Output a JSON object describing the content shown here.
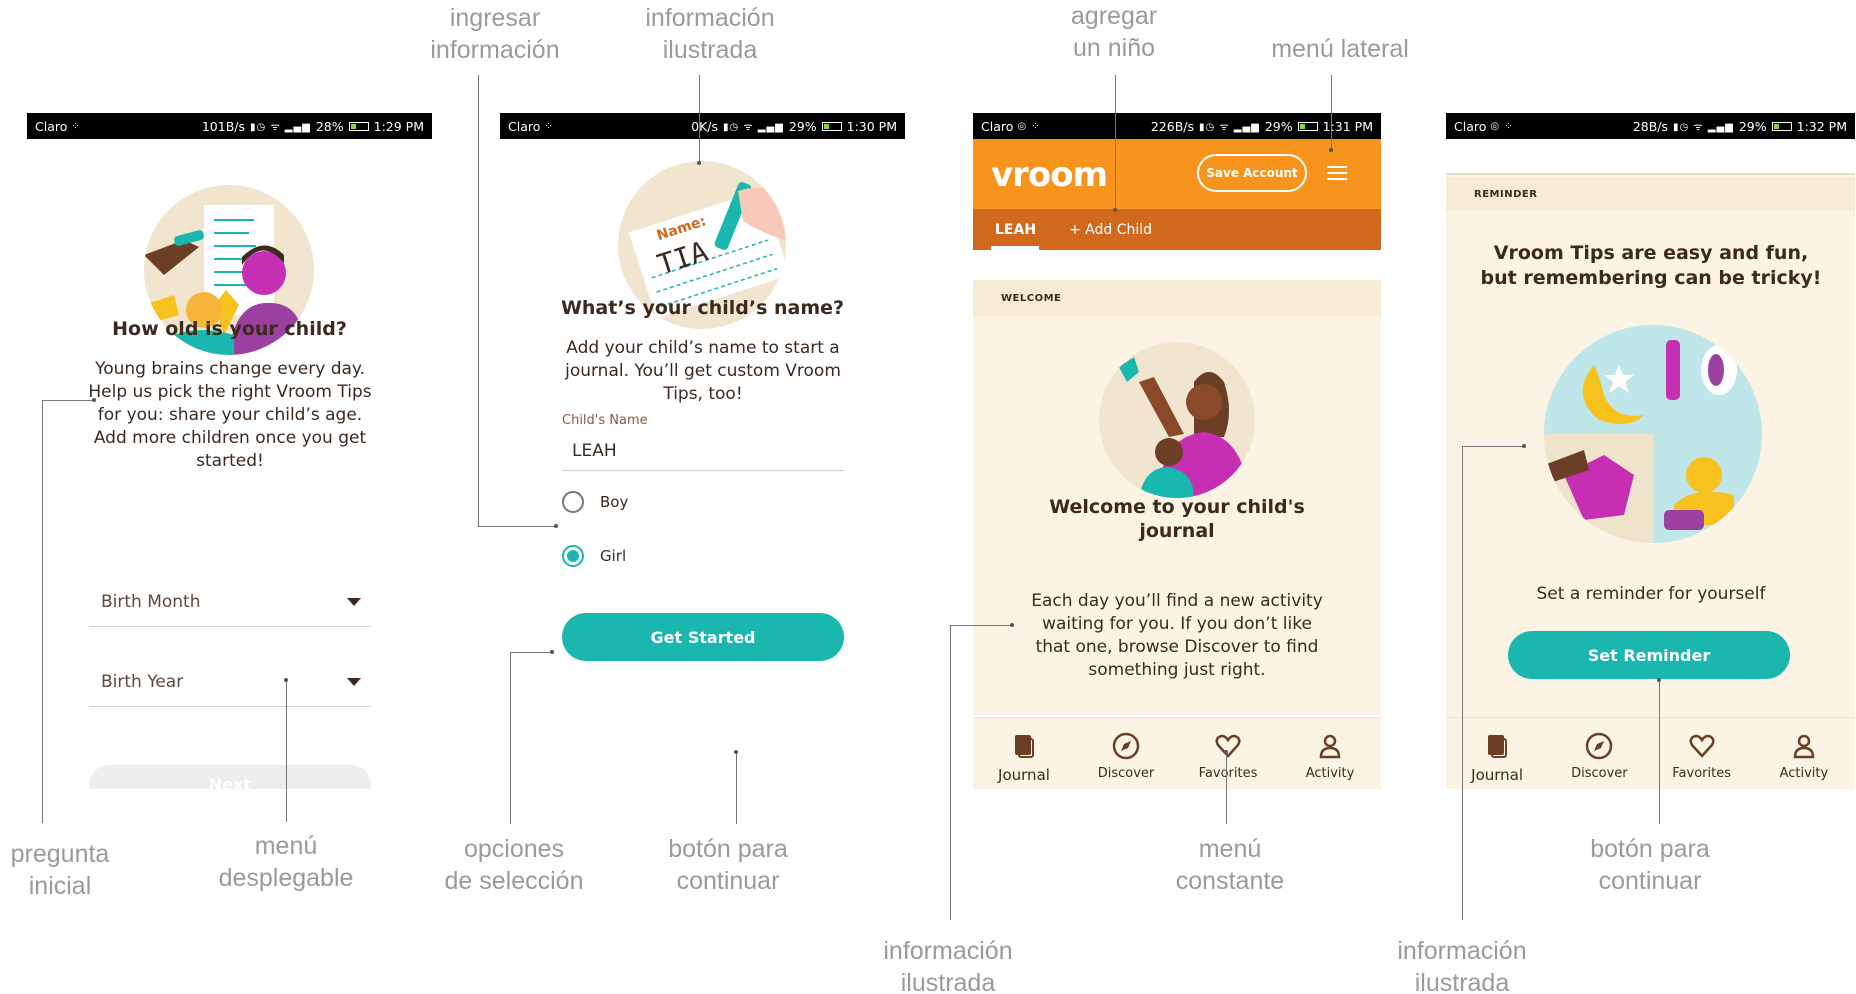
{
  "status_bars": [
    {
      "carrier": "Claro",
      "net": "101B/s",
      "battery": "28%",
      "time": "1:29 PM"
    },
    {
      "carrier": "Claro",
      "net": "0K/s",
      "battery": "29%",
      "time": "1:30 PM"
    },
    {
      "carrier": "Claro",
      "net": "226B/s",
      "battery": "29%",
      "time": "1:31 PM"
    },
    {
      "carrier": "Claro",
      "net": "28B/s",
      "battery": "29%",
      "time": "1:32 PM"
    }
  ],
  "screen1": {
    "title": "How old is your child?",
    "body": "Young brains change every day. Help us pick the right Vroom Tips for you: share your child’s age. Add more children once you get started!",
    "birth_month_label": "Birth Month",
    "birth_year_label": "Birth Year",
    "next_label": "Next"
  },
  "screen2": {
    "illus_name_text": "Name:",
    "illus_written": "TIA",
    "title": "What’s your child’s name?",
    "body": "Add your child’s name to start a journal. You’ll get custom Vroom Tips, too!",
    "field_label": "Child's Name",
    "field_value": "LEAH",
    "options": [
      "Boy",
      "Girl"
    ],
    "selected_option": "Girl",
    "cta": "Get Started"
  },
  "screen3": {
    "logo": "vroom",
    "save_account": "Save Account",
    "tab_child": "LEAH",
    "tab_add": "+ Add Child",
    "section_label": "WELCOME",
    "title": "Welcome to your child's journal",
    "body": "Each day you’ll find a new activity waiting for you. If you don’t like that one, browse Discover to find something just right."
  },
  "screen4": {
    "section_label": "REMINDER",
    "title": "Vroom Tips are easy and fun, but remembering can be tricky!",
    "subtitle": "Set a reminder for yourself",
    "cta": "Set Reminder"
  },
  "bottom_nav": [
    "Journal",
    "Discover",
    "Favorites",
    "Activity"
  ],
  "annotations": {
    "ingresar_informacion": "ingresar\ninformación",
    "informacion_ilustrada_top": "información\nilustrada",
    "agregar_nino": "agregar\nun niño",
    "menu_lateral": "menú lateral",
    "pregunta_inicial": "pregunta\ninicial",
    "menu_desplegable": "menú\ndesplegable",
    "opciones_seleccion": "opciones\nde selección",
    "boton_continuar_1": "botón para\ncontinuar",
    "menu_constante": "menú\nconstante",
    "boton_continuar_2": "botón para\ncontinuar",
    "informacion_ilustrada_3": "información\nilustrada",
    "informacion_ilustrada_4": "información\nilustrada"
  },
  "colors": {
    "teal": "#19b7ad",
    "orange": "#f7941e",
    "dark_orange": "#d0681d",
    "cream": "#fbf3e4",
    "brown_text": "#3b2a1d",
    "annotation_gray": "#9a9a9a"
  }
}
